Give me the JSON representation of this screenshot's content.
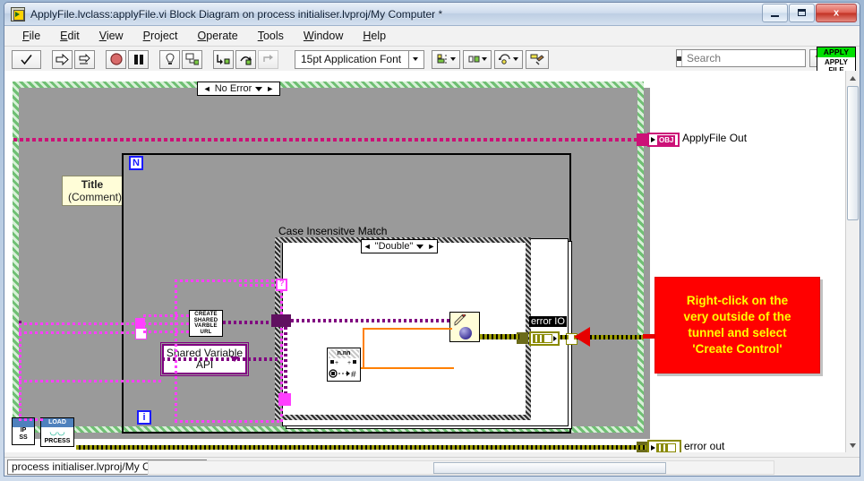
{
  "window": {
    "title": "ApplyFile.lvclass:applyFile.vi Block Diagram on process initialiser.lvproj/My Computer *",
    "icon_name": "labview-vi-icon",
    "minimize_label": "Minimize",
    "maximize_label": "Maximize",
    "close_label": "Close",
    "close_glyph": "x"
  },
  "menubar": {
    "items": [
      {
        "label": "File",
        "accel": "F"
      },
      {
        "label": "Edit",
        "accel": "E"
      },
      {
        "label": "View",
        "accel": "V"
      },
      {
        "label": "Project",
        "accel": "P"
      },
      {
        "label": "Operate",
        "accel": "O"
      },
      {
        "label": "Tools",
        "accel": "T"
      },
      {
        "label": "Window",
        "accel": "W"
      },
      {
        "label": "Help",
        "accel": "H"
      }
    ]
  },
  "toolbar": {
    "run_label": "Run",
    "run_continuous_label": "Run Continuously",
    "abort_label": "Abort Execution",
    "pause_label": "Pause",
    "highlight_label": "Highlight Execution",
    "retain_values_label": "Retain Wire Values",
    "step_into_label": "Step Into",
    "step_over_label": "Step Over",
    "step_out_label": "Step Out",
    "font_selector_value": "15pt Application Font",
    "align_label": "Align Objects",
    "distribute_label": "Distribute Objects",
    "resize_label": "Resize Objects",
    "reorder_label": "Reorder",
    "cleanup_label": "Clean Up Diagram",
    "search_placeholder": "Search",
    "search_value": "",
    "help_label": "Context Help",
    "apply_badge_top": "APPLY",
    "apply_badge_bottom": "APPLY FILE"
  },
  "diagram": {
    "error_case_selector": "No Error",
    "comment_title": "Title",
    "comment_subtitle": "(Comment)",
    "loop_badge_top": "N",
    "loop_badge_bottom": "i",
    "case_structure_label": "Case Insensitve Match",
    "case_structure_selector": "\"Double\"",
    "create_url_icon_text": "CREATE SHARED VARBLE URL",
    "create_url_line1": "CREATE",
    "create_url_line2": "SHARED",
    "create_url_line3": "VARBLE",
    "create_url_line4": "URL",
    "shared_variable_api_line1": "Shared Variable",
    "shared_variable_api_line2": "API",
    "error_io_label": "error IO",
    "number_node_label": "n.nn",
    "apply_file_out_label": "ApplyFile Out",
    "apply_file_out_chip": "OBJ",
    "error_out_label": "error out",
    "ip_node_label_line1": "IP",
    "ip_node_label_line2": "SS",
    "load_node_head": "LOAD",
    "load_node_foot": "PRCESS",
    "load_node_glyph": "👓"
  },
  "callout": {
    "line1": "Right-click on the",
    "line2": "very outside of the",
    "line3": "tunnel and select",
    "line4": "'Create Control'",
    "background_color": "#ff0000",
    "text_color": "#ffff00"
  },
  "statusbar": {
    "path": "process initialiser.lvproj/My Computer",
    "collapse_glyph": "◄"
  },
  "colors": {
    "wire_object": "#cc1177",
    "wire_refnum": "#ff3fff",
    "wire_purple": "#800080",
    "wire_error": "#9a9a00",
    "wire_orange": "#ff8000",
    "structure_green": "#6fbf73",
    "callout_red": "#ff0000",
    "callout_yellow": "#ffff00"
  }
}
